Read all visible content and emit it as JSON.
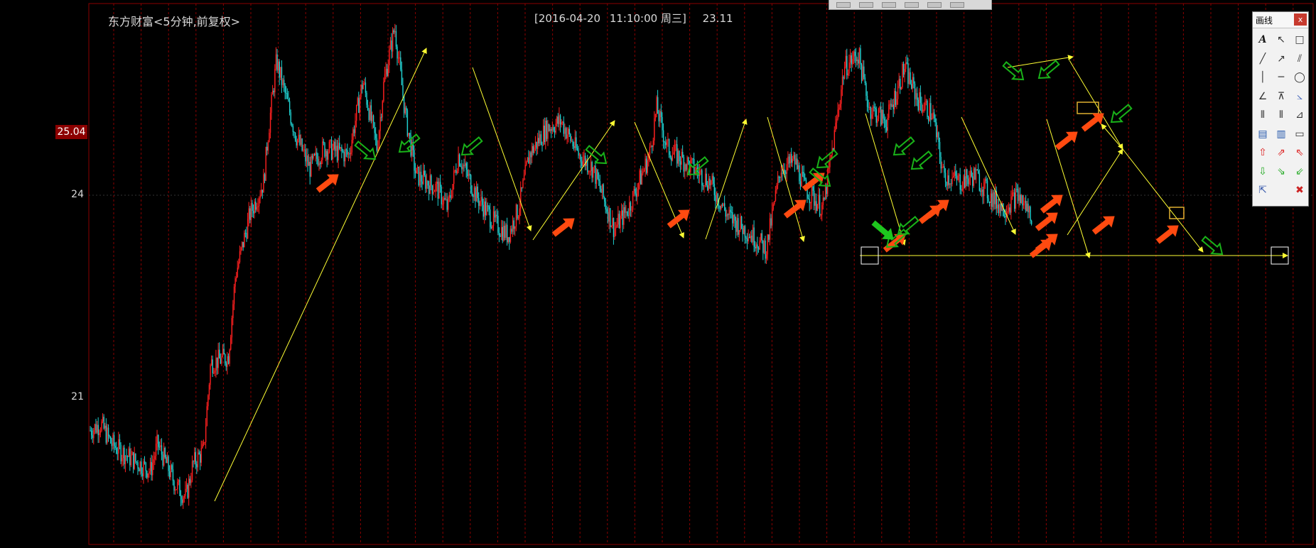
{
  "window": {
    "title": "东方财富<5分钟,前复权>",
    "cursor_date": "[2016-04-20",
    "cursor_time": "11:10:00 周三]",
    "cursor_price": "23.11"
  },
  "y_axis": {
    "labels": [
      "24",
      "21"
    ],
    "highlight_price": "25.04"
  },
  "top_toolbar": {
    "buttons": [
      "tool-a",
      "tool-b",
      "tool-c",
      "tool-d",
      "tool-e",
      "tool-f"
    ]
  },
  "draw_panel": {
    "title": "画线",
    "close_label": "x",
    "tools": [
      {
        "name": "text-tool",
        "glyph": "A",
        "color": "#1a1a1a"
      },
      {
        "name": "select-arrow-tool",
        "glyph": "↖",
        "color": "#333333"
      },
      {
        "name": "rectangle-tool",
        "glyph": "□",
        "color": "#333333"
      },
      {
        "name": "line-segment-tool",
        "glyph": "╱",
        "color": "#333333"
      },
      {
        "name": "ray-tool",
        "glyph": "↗",
        "color": "#333333"
      },
      {
        "name": "parallel-lines-tool",
        "glyph": "⫽",
        "color": "#333333"
      },
      {
        "name": "vertical-line-tool",
        "glyph": "│",
        "color": "#333333"
      },
      {
        "name": "horizontal-line-tool",
        "glyph": "─",
        "color": "#333333"
      },
      {
        "name": "ellipse-tool",
        "glyph": "◯",
        "color": "#333333"
      },
      {
        "name": "angle-tool",
        "glyph": "∠",
        "color": "#333333"
      },
      {
        "name": "fan-lines-tool",
        "glyph": "⊼",
        "color": "#333333"
      },
      {
        "name": "gann-fan-tool",
        "glyph": "⦣",
        "color": "#4466bb"
      },
      {
        "name": "cycle-lines-tool",
        "glyph": "⦀",
        "color": "#333333"
      },
      {
        "name": "fibonacci-time-tool",
        "glyph": "⦀",
        "color": "#333333"
      },
      {
        "name": "fibonacci-fan-tool",
        "glyph": "⊿",
        "color": "#333333"
      },
      {
        "name": "text-box-tool",
        "glyph": "▤",
        "color": "#2255aa"
      },
      {
        "name": "note-tool",
        "glyph": "▥",
        "color": "#2255aa"
      },
      {
        "name": "ruler-tool",
        "glyph": "▭",
        "color": "#333333"
      },
      {
        "name": "up-arrow-mark",
        "glyph": "⇧",
        "color": "#dd2222"
      },
      {
        "name": "up-right-arrow-mark",
        "glyph": "⇗",
        "color": "#dd2222"
      },
      {
        "name": "up-left-arrow-mark",
        "glyph": "⇖",
        "color": "#dd2222"
      },
      {
        "name": "down-arrow-mark",
        "glyph": "⇩",
        "color": "#22aa22"
      },
      {
        "name": "down-right-arrow-mark",
        "glyph": "⇘",
        "color": "#22aa22"
      },
      {
        "name": "down-left-arrow-mark",
        "glyph": "⇙",
        "color": "#22aa22"
      },
      {
        "name": "pointer-tool",
        "glyph": "⇱",
        "color": "#3355aa"
      },
      {
        "name": "blank-slot",
        "glyph": "",
        "color": "#333333"
      },
      {
        "name": "delete-all-tool",
        "glyph": "✖",
        "color": "#cc2222"
      }
    ]
  },
  "colors": {
    "background": "#000000",
    "grid_red": "#8a0000",
    "candle_up": "#ff2020",
    "candle_down": "#20d0d0",
    "trendline": "#ffff33",
    "sell_arrow": "#ff4a10",
    "buy_arrow": "#19b219"
  }
}
